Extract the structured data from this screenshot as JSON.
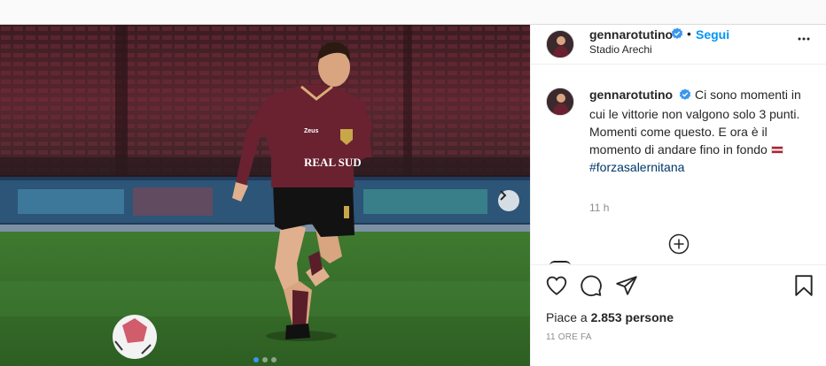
{
  "post": {
    "username": "gennarotutino",
    "verified": true,
    "separator": "•",
    "follow_label": "Segui",
    "location": "Stadio Arechi",
    "photo": {
      "shirt_sponsor": "REAL SUD",
      "shirt_brand": "Zeus",
      "carousel_count": 3,
      "carousel_active": 1
    },
    "caption": {
      "username": "gennarotutino",
      "text": "Ci sono momenti in cui le vittorie non valgono solo 3 punti. Momenti come questo. E ora è il momento di andare fino in fondo",
      "flag_icon": "latvia-flag-emoji",
      "hashtag": "#forzasalernitana",
      "time_ago": "11 h"
    },
    "likes_prefix": "Piace a",
    "likes_count": "2.853 persone",
    "date": "11 ORE FA"
  },
  "colors": {
    "accent": "#0095f6",
    "hashtag": "#00376b",
    "muted": "#8e8e8e",
    "jersey": "#6a2230",
    "pitch": "#3e7d2e"
  }
}
